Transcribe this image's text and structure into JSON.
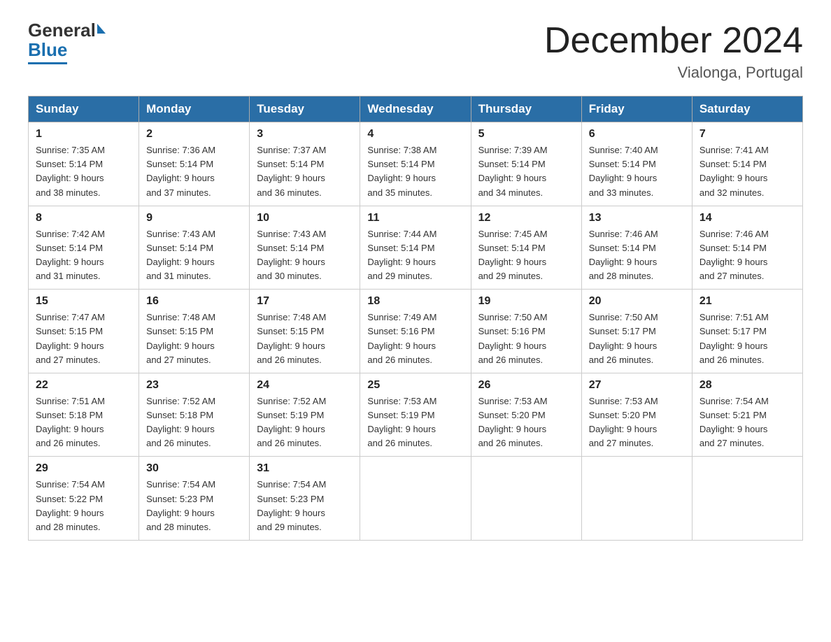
{
  "header": {
    "logo_general": "General",
    "logo_blue": "Blue",
    "month_title": "December 2024",
    "location": "Vialonga, Portugal"
  },
  "days_of_week": [
    "Sunday",
    "Monday",
    "Tuesday",
    "Wednesday",
    "Thursday",
    "Friday",
    "Saturday"
  ],
  "weeks": [
    [
      {
        "day": "1",
        "sunrise": "7:35 AM",
        "sunset": "5:14 PM",
        "daylight": "9 hours and 38 minutes."
      },
      {
        "day": "2",
        "sunrise": "7:36 AM",
        "sunset": "5:14 PM",
        "daylight": "9 hours and 37 minutes."
      },
      {
        "day": "3",
        "sunrise": "7:37 AM",
        "sunset": "5:14 PM",
        "daylight": "9 hours and 36 minutes."
      },
      {
        "day": "4",
        "sunrise": "7:38 AM",
        "sunset": "5:14 PM",
        "daylight": "9 hours and 35 minutes."
      },
      {
        "day": "5",
        "sunrise": "7:39 AM",
        "sunset": "5:14 PM",
        "daylight": "9 hours and 34 minutes."
      },
      {
        "day": "6",
        "sunrise": "7:40 AM",
        "sunset": "5:14 PM",
        "daylight": "9 hours and 33 minutes."
      },
      {
        "day": "7",
        "sunrise": "7:41 AM",
        "sunset": "5:14 PM",
        "daylight": "9 hours and 32 minutes."
      }
    ],
    [
      {
        "day": "8",
        "sunrise": "7:42 AM",
        "sunset": "5:14 PM",
        "daylight": "9 hours and 31 minutes."
      },
      {
        "day": "9",
        "sunrise": "7:43 AM",
        "sunset": "5:14 PM",
        "daylight": "9 hours and 31 minutes."
      },
      {
        "day": "10",
        "sunrise": "7:43 AM",
        "sunset": "5:14 PM",
        "daylight": "9 hours and 30 minutes."
      },
      {
        "day": "11",
        "sunrise": "7:44 AM",
        "sunset": "5:14 PM",
        "daylight": "9 hours and 29 minutes."
      },
      {
        "day": "12",
        "sunrise": "7:45 AM",
        "sunset": "5:14 PM",
        "daylight": "9 hours and 29 minutes."
      },
      {
        "day": "13",
        "sunrise": "7:46 AM",
        "sunset": "5:14 PM",
        "daylight": "9 hours and 28 minutes."
      },
      {
        "day": "14",
        "sunrise": "7:46 AM",
        "sunset": "5:14 PM",
        "daylight": "9 hours and 27 minutes."
      }
    ],
    [
      {
        "day": "15",
        "sunrise": "7:47 AM",
        "sunset": "5:15 PM",
        "daylight": "9 hours and 27 minutes."
      },
      {
        "day": "16",
        "sunrise": "7:48 AM",
        "sunset": "5:15 PM",
        "daylight": "9 hours and 27 minutes."
      },
      {
        "day": "17",
        "sunrise": "7:48 AM",
        "sunset": "5:15 PM",
        "daylight": "9 hours and 26 minutes."
      },
      {
        "day": "18",
        "sunrise": "7:49 AM",
        "sunset": "5:16 PM",
        "daylight": "9 hours and 26 minutes."
      },
      {
        "day": "19",
        "sunrise": "7:50 AM",
        "sunset": "5:16 PM",
        "daylight": "9 hours and 26 minutes."
      },
      {
        "day": "20",
        "sunrise": "7:50 AM",
        "sunset": "5:17 PM",
        "daylight": "9 hours and 26 minutes."
      },
      {
        "day": "21",
        "sunrise": "7:51 AM",
        "sunset": "5:17 PM",
        "daylight": "9 hours and 26 minutes."
      }
    ],
    [
      {
        "day": "22",
        "sunrise": "7:51 AM",
        "sunset": "5:18 PM",
        "daylight": "9 hours and 26 minutes."
      },
      {
        "day": "23",
        "sunrise": "7:52 AM",
        "sunset": "5:18 PM",
        "daylight": "9 hours and 26 minutes."
      },
      {
        "day": "24",
        "sunrise": "7:52 AM",
        "sunset": "5:19 PM",
        "daylight": "9 hours and 26 minutes."
      },
      {
        "day": "25",
        "sunrise": "7:53 AM",
        "sunset": "5:19 PM",
        "daylight": "9 hours and 26 minutes."
      },
      {
        "day": "26",
        "sunrise": "7:53 AM",
        "sunset": "5:20 PM",
        "daylight": "9 hours and 26 minutes."
      },
      {
        "day": "27",
        "sunrise": "7:53 AM",
        "sunset": "5:20 PM",
        "daylight": "9 hours and 27 minutes."
      },
      {
        "day": "28",
        "sunrise": "7:54 AM",
        "sunset": "5:21 PM",
        "daylight": "9 hours and 27 minutes."
      }
    ],
    [
      {
        "day": "29",
        "sunrise": "7:54 AM",
        "sunset": "5:22 PM",
        "daylight": "9 hours and 28 minutes."
      },
      {
        "day": "30",
        "sunrise": "7:54 AM",
        "sunset": "5:23 PM",
        "daylight": "9 hours and 28 minutes."
      },
      {
        "day": "31",
        "sunrise": "7:54 AM",
        "sunset": "5:23 PM",
        "daylight": "9 hours and 29 minutes."
      },
      null,
      null,
      null,
      null
    ]
  ],
  "labels": {
    "sunrise": "Sunrise:",
    "sunset": "Sunset:",
    "daylight": "Daylight:"
  },
  "colors": {
    "header_bg": "#2a6ea6",
    "header_text": "#ffffff",
    "border": "#aaaaaa"
  }
}
